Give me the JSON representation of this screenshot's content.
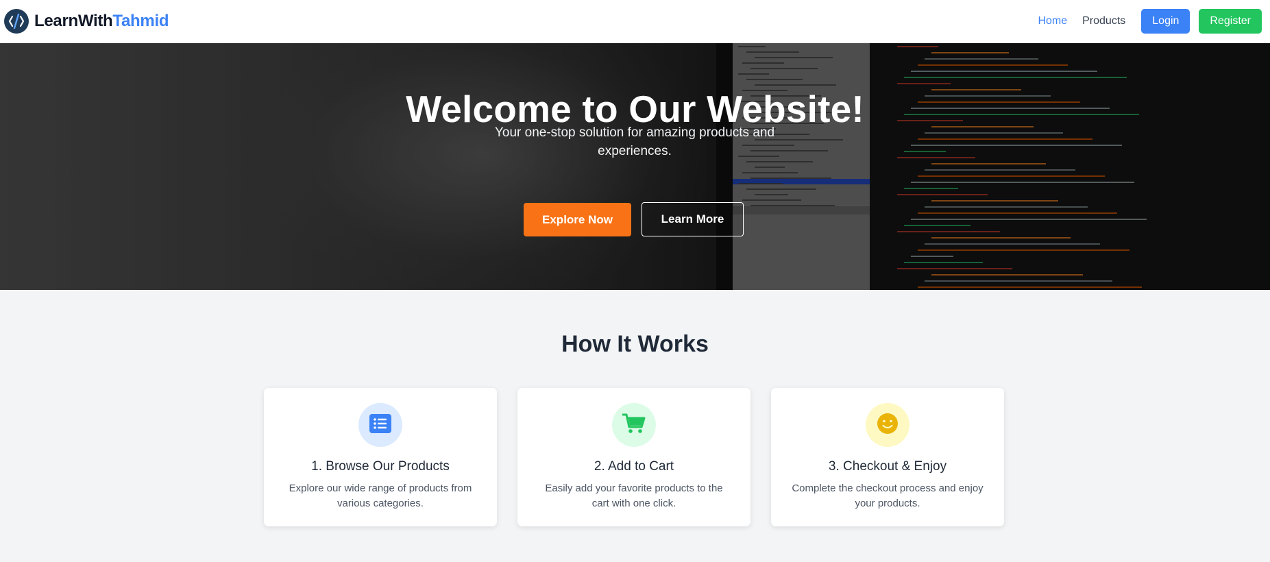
{
  "navbar": {
    "brand_part1": "LearnWith",
    "brand_part2": "Tahmid",
    "logo_icon": "code-slash-icon",
    "links": [
      {
        "label": "Home",
        "active": true
      },
      {
        "label": "Products",
        "active": false
      }
    ],
    "login_label": "Login",
    "register_label": "Register"
  },
  "hero": {
    "title": "Welcome to Our Website!",
    "subtitle": "Your one-stop solution for amazing products and experiences.",
    "primary_button": "Explore Now",
    "secondary_button": "Learn More"
  },
  "how_it_works": {
    "title": "How It Works",
    "steps": [
      {
        "title": "1. Browse Our Products",
        "description": "Explore our wide range of products from various categories.",
        "icon": "list-icon",
        "icon_color": "#3b82f6",
        "icon_bg": "#dbeafe"
      },
      {
        "title": "2. Add to Cart",
        "description": "Easily add your favorite products to the cart with one click.",
        "icon": "cart-icon",
        "icon_color": "#22c55e",
        "icon_bg": "#dcfce7"
      },
      {
        "title": "3. Checkout & Enjoy",
        "description": "Complete the checkout process and enjoy your products.",
        "icon": "smile-icon",
        "icon_color": "#eab308",
        "icon_bg": "#fef9c3"
      }
    ]
  },
  "colors": {
    "primary": "#3b82f6",
    "success": "#22c55e",
    "accent": "#f97316",
    "background": "#f3f4f6"
  }
}
